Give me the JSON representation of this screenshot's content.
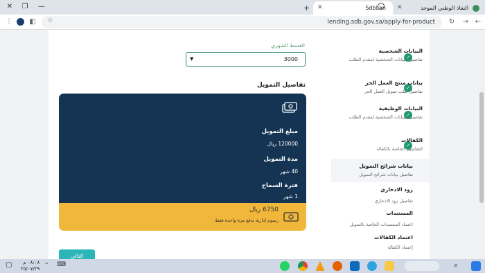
{
  "browser": {
    "tabs": [
      {
        "title": "النفاذ الوطني الموحد",
        "active": false
      },
      {
        "title": "SdbLan",
        "active": true
      }
    ],
    "new_tab_icon": "plus-icon",
    "url": "lending.sdb.gov.sa/apply-for-product"
  },
  "form": {
    "installment_label": "القسط الشهري",
    "installment_value": "3000",
    "finance_title": "تفاصيل التمويل",
    "card": {
      "amount_label": "مبلغ التمويل",
      "amount_value": "120000 ريال",
      "duration_label": "مدة التمويل",
      "duration_value": "40 شهر",
      "grace_label": "فترة السماح",
      "grace_value": "1 شهر",
      "fee_amount": "6750 ريال",
      "fee_desc": "رسوم إدارية تدفع مرة واحدة فقط",
      "colors": {
        "dark": "#153454",
        "accent": "#f0b73a"
      }
    },
    "next_button": "التالي"
  },
  "steps": [
    {
      "title": "البيانات الشخصية",
      "subtitle": "تفاصيل البيانات الشخصية لمقدم الطلب",
      "done": true
    },
    {
      "title": "بيانات منتج العمل الحر",
      "subtitle": "تفاصيل طلب تمويل العمل الحر",
      "done": true
    },
    {
      "title": "البيانات الوظيفية",
      "subtitle": "تفاصيل البيانات الشخصية لمقدم الطلب",
      "done": true
    },
    {
      "title": "الكفالات",
      "subtitle": "التفاصيل الخاصة بالكفالة",
      "done": true
    },
    {
      "title": "بيانات شرائح التمويل",
      "subtitle": "تفاصيل بيانات شرائح التمويل",
      "done": false,
      "active": true
    },
    {
      "title": "زود الادخاري",
      "subtitle": "تفاصيل زود الادخاري",
      "done": false
    },
    {
      "title": "المستندات",
      "subtitle": "اعتماد المستندات الخاصة بالتمويل",
      "done": false
    },
    {
      "title": "اعتماد الكفالات",
      "subtitle": "إعتماد الكفالة",
      "done": false
    }
  ],
  "taskbar": {
    "time": "٠٨:٠٨ م",
    "date": "٢٥/٠٧/٢٩"
  }
}
